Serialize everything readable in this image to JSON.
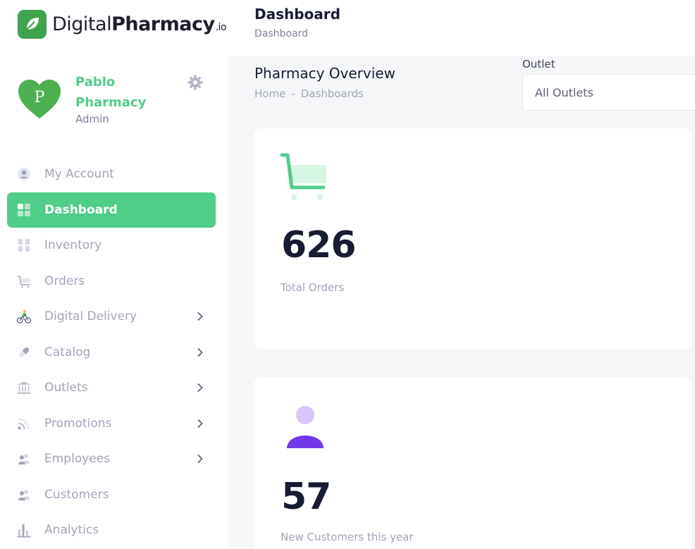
{
  "brand": {
    "name_light": "Digital",
    "name_bold": "Pharmacy",
    "name_suffix": ".io",
    "accent_color": "#50cd89",
    "logo_bg_color": "#3fa24d"
  },
  "profile": {
    "initial": "P",
    "name": "Pablo Pharmacy",
    "role": "Admin"
  },
  "sidebar": {
    "items": [
      {
        "label": "My Account",
        "icon": "user-circle-icon",
        "has_submenu": false,
        "active": false
      },
      {
        "label": "Dashboard",
        "icon": "grid-icon",
        "has_submenu": false,
        "active": true
      },
      {
        "label": "Inventory",
        "icon": "inventory-grid-icon",
        "has_submenu": false,
        "active": false
      },
      {
        "label": "Orders",
        "icon": "cart-icon",
        "has_submenu": false,
        "active": false
      },
      {
        "label": "Digital Delivery",
        "icon": "cyclist-icon",
        "has_submenu": true,
        "active": false
      },
      {
        "label": "Catalog",
        "icon": "pill-icon",
        "has_submenu": true,
        "active": false
      },
      {
        "label": "Outlets",
        "icon": "bank-icon",
        "has_submenu": true,
        "active": false
      },
      {
        "label": "Promotions",
        "icon": "rss-icon",
        "has_submenu": true,
        "active": false
      },
      {
        "label": "Employees",
        "icon": "people-icon",
        "has_submenu": true,
        "active": false
      },
      {
        "label": "Customers",
        "icon": "people-icon",
        "has_submenu": false,
        "active": false
      },
      {
        "label": "Analytics",
        "icon": "bar-chart-icon",
        "has_submenu": false,
        "active": false
      }
    ]
  },
  "header": {
    "title": "Dashboard",
    "subtitle": "Dashboard"
  },
  "toolbar": {
    "title": "Pharmacy Overview",
    "breadcrumbs": [
      "Home",
      "Dashboards"
    ],
    "breadcrumb_separator": "-",
    "outlet_label": "Outlet",
    "outlet_selected": "All Outlets"
  },
  "stats": [
    {
      "value": "626",
      "caption": "Total Orders",
      "icon": "cart-icon",
      "color": "#50cd89"
    },
    {
      "value": "57",
      "caption": "New Customers this year",
      "icon": "user-icon",
      "color": "#7239ea"
    }
  ]
}
